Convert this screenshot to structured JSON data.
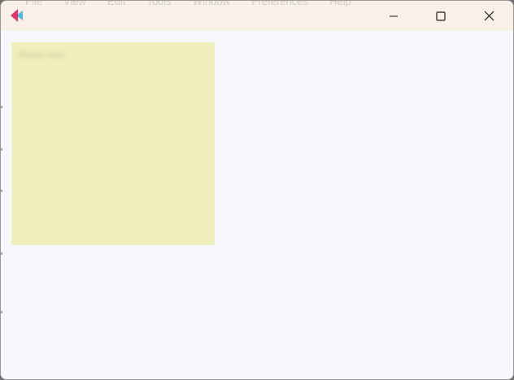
{
  "window": {
    "app_icon": "fast-forward-colored-icon",
    "controls": {
      "minimize_icon": "minimize-icon",
      "maximize_icon": "maximize-icon",
      "close_icon": "close-icon"
    }
  },
  "menu_bar": {
    "items": [
      "File",
      "View",
      "Edit",
      "Tools",
      "Window",
      "Preferences",
      "Help"
    ]
  },
  "sticky_note": {
    "title": "Sticky note",
    "color": "#f0f0bd"
  },
  "colors": {
    "titlebar": "#f9f1e8",
    "background": "#f7f8fe",
    "icon_pink": "#e8336d",
    "icon_blue": "#3fb6d8"
  }
}
